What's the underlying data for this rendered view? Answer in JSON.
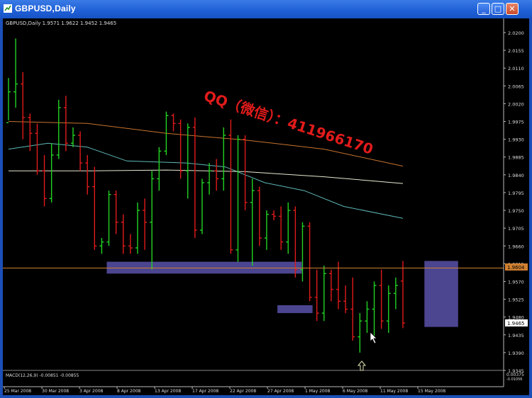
{
  "window": {
    "title": "GBPUSD,Daily",
    "buttons": {
      "minimize": "_",
      "maximize": "□",
      "close": "✕"
    }
  },
  "chart_info": {
    "symbol_line": "GBPUSD,Daily  1.9571 1.9622 1.9452 1.9465",
    "current_price_label": "1.9465",
    "level_label": "1.9604",
    "macd_label": "MACD(12,26,9) -0.00851 -0.00855",
    "macd_scale_top": "0.00375",
    "macd_scale_bottom": "-0.01056",
    "watermark": "QQ（微信）：411966170"
  },
  "chart_data": {
    "type": "candlestick",
    "price_axis": [
      "2.0200",
      "2.0155",
      "2.0110",
      "2.0065",
      "2.0020",
      "1.9975",
      "1.9930",
      "1.9885",
      "1.9840",
      "1.9795",
      "1.9750",
      "1.9705",
      "1.9660",
      "1.9615",
      "1.9570",
      "1.9525",
      "1.9480",
      "1.9435",
      "1.9390",
      "1.9345"
    ],
    "date_axis": [
      "25 Mar 2008",
      "30 Mar 2008",
      "3 Apr 2008",
      "8 Apr 2008",
      "13 Apr 2008",
      "17 Apr 2008",
      "22 Apr 2008",
      "27 Apr 2008",
      "1 May 2008",
      "6 May 2008",
      "11 May 2008",
      "15 May 2008"
    ],
    "ylim": [
      1.9345,
      2.02
    ],
    "horizontal_line": 1.9604,
    "bars": [
      [
        1.9972,
        2.0085,
        1.9978,
        2.005
      ],
      [
        2.005,
        2.0185,
        2.001,
        2.007
      ],
      [
        2.007,
        2.01,
        1.993,
        1.9985
      ],
      [
        1.9985,
        1.9995,
        1.99,
        1.9945
      ],
      [
        1.9945,
        1.997,
        1.984,
        1.985
      ],
      [
        1.985,
        1.989,
        1.976,
        1.978
      ],
      [
        1.978,
        1.992,
        1.977,
        1.989
      ],
      [
        1.989,
        2.003,
        1.988,
        2.001
      ],
      [
        2.001,
        2.004,
        1.99,
        1.992
      ],
      [
        1.992,
        1.996,
        1.991,
        1.994
      ],
      [
        1.994,
        1.995,
        1.985,
        1.987
      ],
      [
        1.987,
        1.989,
        1.979,
        1.981
      ],
      [
        1.981,
        1.986,
        1.965,
        1.966
      ],
      [
        1.966,
        1.968,
        1.964,
        1.967
      ],
      [
        1.967,
        1.98,
        1.966,
        1.979
      ],
      [
        1.979,
        1.98,
        1.969,
        1.972
      ],
      [
        1.972,
        1.974,
        1.964,
        1.966
      ],
      [
        1.966,
        1.969,
        1.964,
        1.9655
      ],
      [
        1.9655,
        1.977,
        1.964,
        1.975
      ],
      [
        1.975,
        1.978,
        1.965,
        1.972
      ],
      [
        1.972,
        1.985,
        1.96,
        1.983
      ],
      [
        1.983,
        1.991,
        1.98,
        1.99
      ],
      [
        1.99,
        2.0,
        1.989,
        1.999
      ],
      [
        1.999,
        1.9995,
        1.995,
        1.997
      ],
      [
        1.997,
        1.998,
        1.983,
        1.985
      ],
      [
        1.985,
        1.997,
        1.978,
        1.996
      ],
      [
        1.996,
        1.9985,
        1.968,
        1.97
      ],
      [
        1.97,
        1.983,
        1.969,
        1.982
      ],
      [
        1.982,
        1.987,
        1.979,
        1.985
      ],
      [
        1.985,
        1.988,
        1.98,
        1.983
      ],
      [
        1.983,
        1.996,
        1.98,
        1.994
      ],
      [
        1.994,
        1.998,
        1.964,
        1.965
      ],
      [
        1.965,
        1.994,
        1.962,
        1.993
      ],
      [
        1.993,
        1.994,
        1.975,
        1.977
      ],
      [
        1.977,
        1.983,
        1.961,
        1.98
      ],
      [
        1.98,
        1.981,
        1.966,
        1.968
      ],
      [
        1.968,
        1.975,
        1.965,
        1.974
      ],
      [
        1.974,
        1.975,
        1.9725,
        1.9735
      ],
      [
        1.9735,
        1.976,
        1.965,
        1.967
      ],
      [
        1.967,
        1.977,
        1.964,
        1.975
      ],
      [
        1.975,
        1.976,
        1.958,
        1.96
      ],
      [
        1.96,
        1.972,
        1.957,
        1.971
      ],
      [
        1.971,
        1.972,
        1.952,
        1.953
      ],
      [
        1.953,
        1.96,
        1.947,
        1.949
      ],
      [
        1.949,
        1.961,
        1.947,
        1.959
      ],
      [
        1.959,
        1.96,
        1.952,
        1.955
      ],
      [
        1.955,
        1.962,
        1.95,
        1.952
      ],
      [
        1.952,
        1.956,
        1.949,
        1.95
      ],
      [
        1.95,
        1.958,
        1.942,
        1.943
      ],
      [
        1.943,
        1.949,
        1.939,
        1.947
      ],
      [
        1.947,
        1.952,
        1.944,
        1.95
      ],
      [
        1.95,
        1.957,
        1.943,
        1.956
      ],
      [
        1.956,
        1.96,
        1.945,
        1.947
      ],
      [
        1.947,
        1.956,
        1.944,
        1.954
      ],
      [
        1.954,
        1.958,
        1.95,
        1.956
      ],
      [
        1.9571,
        1.9622,
        1.9452,
        1.9465
      ]
    ],
    "moving_averages": [
      {
        "color": "#c8732e",
        "points": [
          [
            0,
            1.9975
          ],
          [
            20,
            1.997
          ],
          [
            40,
            1.9945
          ],
          [
            60,
            1.9928
          ],
          [
            80,
            1.9905
          ],
          [
            100,
            1.9862
          ]
        ]
      },
      {
        "color": "#5fb8b8",
        "points": [
          [
            0,
            1.9905
          ],
          [
            10,
            1.992
          ],
          [
            20,
            1.991
          ],
          [
            30,
            1.9875
          ],
          [
            45,
            1.987
          ],
          [
            55,
            1.986
          ],
          [
            65,
            1.982
          ],
          [
            75,
            1.98
          ],
          [
            85,
            1.976
          ],
          [
            100,
            1.973
          ]
        ]
      },
      {
        "color": "#e8e8d0",
        "points": [
          [
            0,
            1.985
          ],
          [
            20,
            1.985
          ],
          [
            40,
            1.9852
          ],
          [
            60,
            1.9848
          ],
          [
            80,
            1.9835
          ],
          [
            100,
            1.9818
          ]
        ]
      }
    ],
    "zones": [
      {
        "from": 13.7,
        "to": 40.9,
        "top": 1.962,
        "bottom": 1.959
      },
      {
        "from": 37.5,
        "to": 42.4,
        "top": 1.951,
        "bottom": 1.949
      },
      {
        "from": 58.0,
        "to": 62.7,
        "top": 1.9622,
        "bottom": 1.9455
      }
    ]
  }
}
